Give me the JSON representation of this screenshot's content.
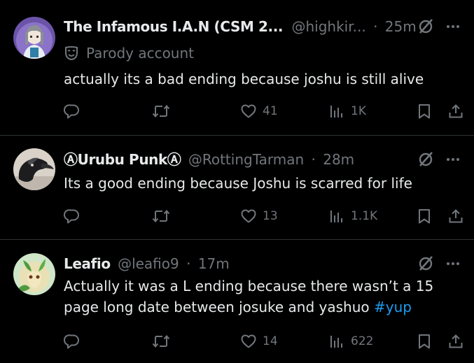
{
  "tweets": [
    {
      "display_name": "The Infamous I.A.N (CSM 2...",
      "handle": "@highkir...",
      "separator": "·",
      "time": "25m",
      "parody_label": "Parody account",
      "text": "actually its a bad ending because joshu is still alive",
      "hashtag": "",
      "likes": "41",
      "views": "1K"
    },
    {
      "display_name": "ⒶUrubu PunkⒶ",
      "handle": "@RottingTarman",
      "separator": "·",
      "time": "28m",
      "text": "Its a good ending because Joshu is scarred for life",
      "hashtag": "",
      "likes": "13",
      "views": "1.1K"
    },
    {
      "display_name": "Leafio",
      "handle": "@leafio9",
      "separator": "·",
      "time": "17m",
      "text": "Actually it was a L ending because there wasn’t a 15 page long date between josuke and yashuo ",
      "hashtag": "#yup",
      "likes": "14",
      "views": "622"
    }
  ],
  "colors": {
    "background": "#000000",
    "primary_text": "#e7e9ea",
    "secondary_text": "#71767b",
    "divider": "#2f3336",
    "link": "#1d9bf0"
  },
  "icons": {
    "reply": "reply-icon",
    "retweet": "retweet-icon",
    "like": "heart-icon",
    "views": "views-icon",
    "bookmark": "bookmark-icon",
    "share": "share-icon",
    "grok": "grok-icon",
    "more": "more-icon",
    "parody": "mask-icon"
  }
}
